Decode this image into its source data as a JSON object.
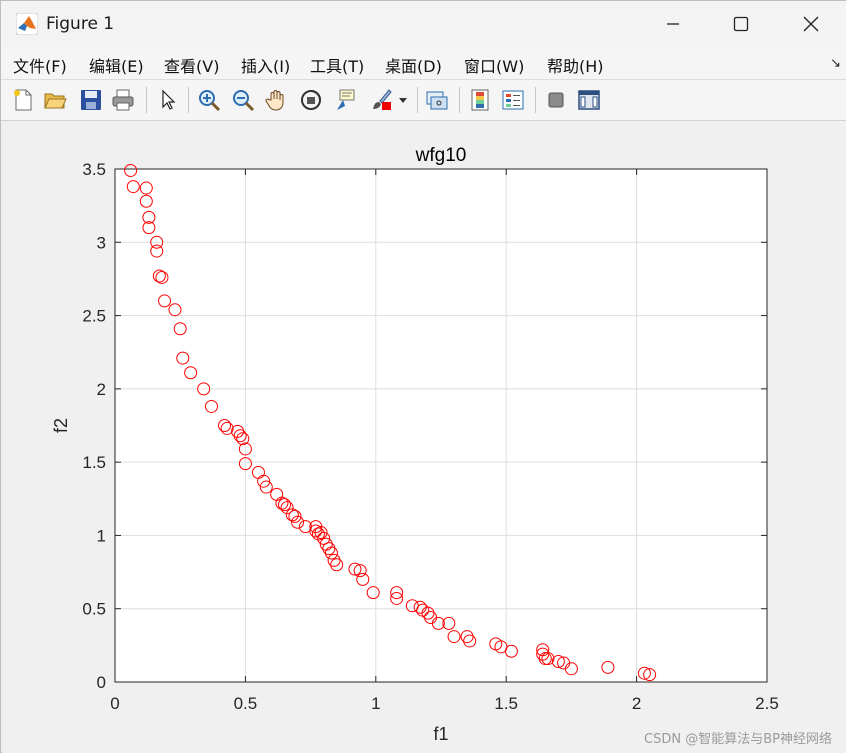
{
  "window": {
    "title": "Figure 1"
  },
  "menu": {
    "items": [
      "文件(F)",
      "编辑(E)",
      "查看(V)",
      "插入(I)",
      "工具(T)",
      "桌面(D)",
      "窗口(W)",
      "帮助(H)"
    ]
  },
  "toolbar": {
    "buttons": [
      "new-figure",
      "open-file",
      "save",
      "print",
      "edit-plot",
      "zoom-in",
      "zoom-out",
      "pan",
      "rotate-3d",
      "data-cursor",
      "brush",
      "brush-dropdown",
      "link-plot",
      "insert-colorbar",
      "insert-legend",
      "hide-plot-tools",
      "show-plot-tools"
    ]
  },
  "chart_data": {
    "type": "scatter",
    "title": "wfg10",
    "xlabel": "f1",
    "ylabel": "f2",
    "xlim": [
      0,
      2.5
    ],
    "ylim": [
      0,
      3.5
    ],
    "xticks": [
      "0",
      "0.5",
      "1",
      "1.5",
      "2",
      "2.5"
    ],
    "yticks": [
      "0",
      "0.5",
      "1",
      "1.5",
      "2",
      "2.5",
      "3",
      "3.5"
    ],
    "grid": true,
    "marker": "circle-open",
    "color": "#ff0000",
    "x": [
      0.06,
      0.07,
      0.12,
      0.12,
      0.13,
      0.13,
      0.16,
      0.16,
      0.17,
      0.18,
      0.19,
      0.23,
      0.25,
      0.26,
      0.29,
      0.34,
      0.37,
      0.42,
      0.43,
      0.47,
      0.48,
      0.49,
      0.5,
      0.5,
      0.55,
      0.57,
      0.58,
      0.62,
      0.64,
      0.65,
      0.66,
      0.68,
      0.69,
      0.7,
      0.73,
      0.77,
      0.77,
      0.78,
      0.79,
      0.8,
      0.81,
      0.82,
      0.83,
      0.84,
      0.85,
      0.92,
      0.94,
      0.95,
      0.99,
      1.08,
      1.08,
      1.14,
      1.17,
      1.18,
      1.2,
      1.21,
      1.24,
      1.28,
      1.3,
      1.35,
      1.36,
      1.46,
      1.48,
      1.52,
      1.64,
      1.64,
      1.65,
      1.66,
      1.7,
      1.72,
      1.75,
      1.89,
      2.03,
      2.05
    ],
    "y": [
      3.49,
      3.38,
      3.37,
      3.28,
      3.17,
      3.1,
      3.0,
      2.94,
      2.77,
      2.76,
      2.6,
      2.54,
      2.41,
      2.21,
      2.11,
      2.0,
      1.88,
      1.75,
      1.73,
      1.71,
      1.68,
      1.66,
      1.59,
      1.49,
      1.43,
      1.37,
      1.33,
      1.28,
      1.22,
      1.21,
      1.19,
      1.14,
      1.13,
      1.09,
      1.06,
      1.06,
      1.03,
      1.01,
      1.02,
      0.98,
      0.94,
      0.91,
      0.88,
      0.83,
      0.8,
      0.77,
      0.76,
      0.7,
      0.61,
      0.61,
      0.57,
      0.52,
      0.51,
      0.49,
      0.47,
      0.44,
      0.4,
      0.4,
      0.31,
      0.31,
      0.28,
      0.26,
      0.24,
      0.21,
      0.22,
      0.19,
      0.16,
      0.16,
      0.14,
      0.13,
      0.09,
      0.1,
      0.06,
      0.05
    ]
  },
  "watermark": "CSDN @智能算法与BP神经网络"
}
